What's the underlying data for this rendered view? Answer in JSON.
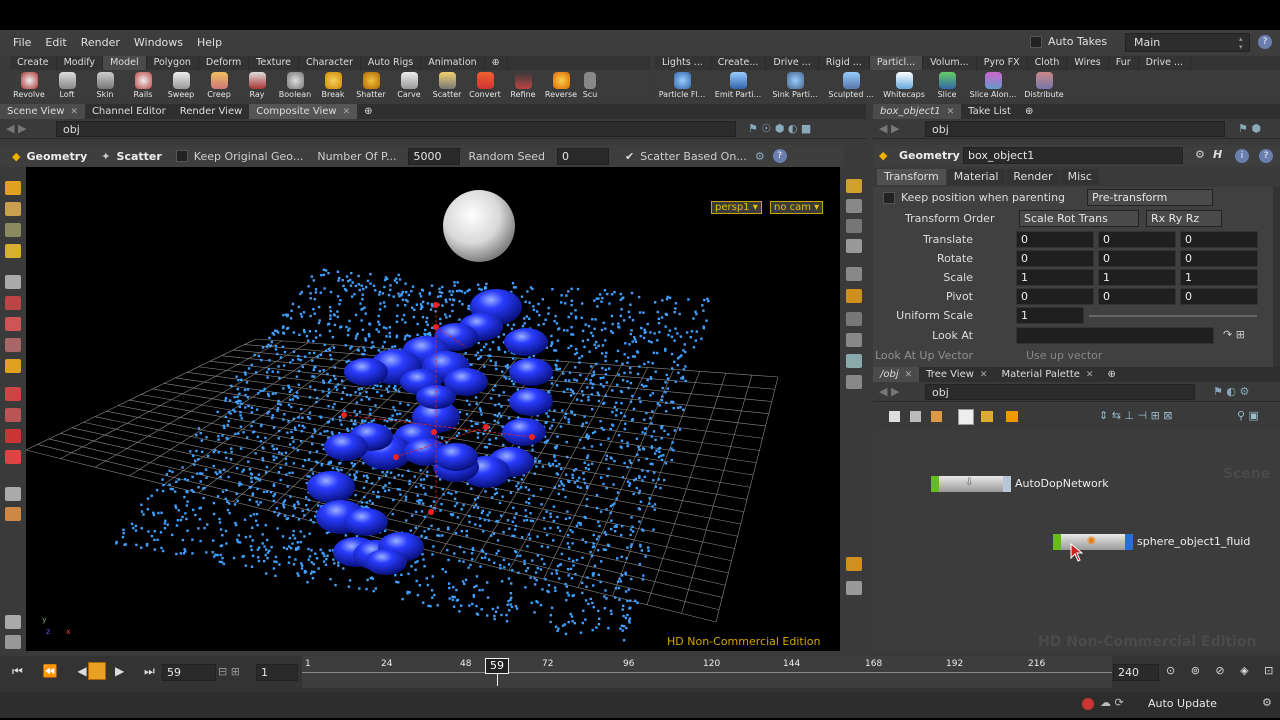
{
  "menu": [
    "File",
    "Edit",
    "Render",
    "Windows",
    "Help"
  ],
  "auto_takes_label": "Auto Takes",
  "desktop": "Main",
  "help_glyph": "?",
  "shelf_left_tabs": [
    "Create",
    "Modify",
    "Model",
    "Polygon",
    "Deform",
    "Texture",
    "Character",
    "Auto Rigs",
    "Animation"
  ],
  "shelf_left_active": "Model",
  "shelf_left_tools": [
    "Revolve",
    "Loft",
    "Skin",
    "Rails",
    "Sweep",
    "Creep",
    "Ray",
    "Boolean",
    "Break",
    "Shatter",
    "Carve",
    "Scatter",
    "Convert",
    "Refine",
    "Reverse",
    "Scu"
  ],
  "shelf_right_tabs": [
    "Lights ...",
    "Create...",
    "Drive ...",
    "Rigid ...",
    "Particl...",
    "Volum...",
    "Pyro FX",
    "Cloth",
    "Wires",
    "Fur",
    "Drive ..."
  ],
  "shelf_right_tools": [
    "Particle Fl...",
    "Emit Parti...",
    "Sink Parti...",
    "Sculpted ...",
    "Whitecaps",
    "Slice",
    "Slice Alon...",
    "Distribute"
  ],
  "left_pane_tabs": [
    "Scene View",
    "Channel Editor",
    "Render View",
    "Composite View"
  ],
  "left_path": "obj",
  "tool_row": {
    "context": "Geometry",
    "tool": "Scatter",
    "keep_label": "Keep Original Geo...",
    "num_label": "Number Of P...",
    "num_value": "5000",
    "seed_label": "Random Seed",
    "seed_value": "0",
    "based_label": "Scatter Based On..."
  },
  "viewport": {
    "camera": "persp1 ▾",
    "no_cam": "no cam ▾",
    "watermark": "HD Non-Commercial Edition",
    "axis_y": "y",
    "axis_z": "z",
    "axis_x": "x"
  },
  "param_tabs_top": [
    "box_object1",
    "Take List"
  ],
  "param_path": "obj",
  "param_header": {
    "context": "Geometry",
    "node": "box_object1"
  },
  "param_tabs": [
    "Transform",
    "Material",
    "Render",
    "Misc"
  ],
  "keep_position_label": "Keep position when parenting",
  "pretransform": "Pre-transform",
  "transform_order": {
    "label": "Transform Order",
    "value": "Scale Rot Trans",
    "rot": "Rx Ry Rz"
  },
  "params": [
    {
      "label": "Translate",
      "values": [
        "0",
        "0",
        "0"
      ]
    },
    {
      "label": "Rotate",
      "values": [
        "0",
        "0",
        "0"
      ]
    },
    {
      "label": "Scale",
      "values": [
        "1",
        "1",
        "1"
      ]
    },
    {
      "label": "Pivot",
      "values": [
        "0",
        "0",
        "0"
      ]
    }
  ],
  "uniform_scale": {
    "label": "Uniform Scale",
    "value": "1"
  },
  "look_at": {
    "label": "Look At"
  },
  "look_up": {
    "label": "Look At Up Vector",
    "value": "Use up vector"
  },
  "net_tabs": [
    "/obj",
    "Tree View",
    "Material Palette"
  ],
  "net_path": "obj",
  "net_watermark_scene": "Scene",
  "net_watermark": "HD Non-Commercial Edition",
  "nodes": [
    {
      "name": "AutoDopNetwork"
    },
    {
      "name": "sphere_object1_fluid"
    }
  ],
  "timeline": {
    "current_frame": "59",
    "step": "1",
    "ticks": [
      "1",
      "24",
      "48",
      "72",
      "96",
      "120",
      "144",
      "168",
      "192",
      "216"
    ],
    "end": "240"
  },
  "status": {
    "auto_update": "Auto Update"
  }
}
